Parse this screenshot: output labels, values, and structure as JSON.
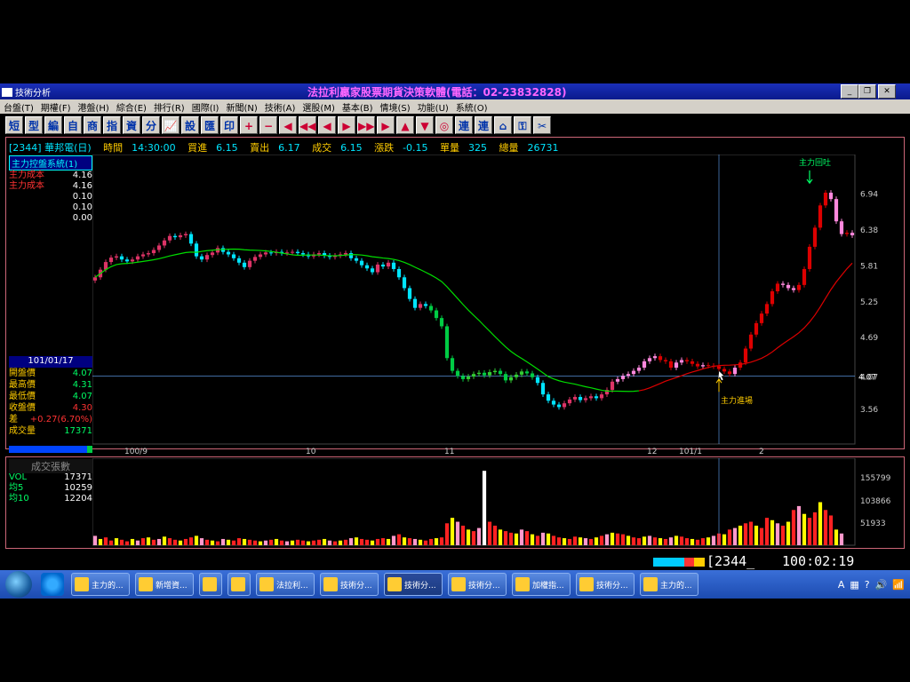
{
  "window": {
    "app_title": "技術分析",
    "brand_title": "法拉利贏家股票期貨決策軟體(電話：02-23832828)"
  },
  "menu": [
    "台盤(T)",
    "期權(F)",
    "港盤(H)",
    "綜合(E)",
    "排行(R)",
    "國際(I)",
    "新聞(N)",
    "技術(A)",
    "選股(M)",
    "基本(B)",
    "情境(S)",
    "功能(U)",
    "系統(O)"
  ],
  "toolbar": [
    {
      "label": "短",
      "cls": ""
    },
    {
      "label": "型",
      "cls": ""
    },
    {
      "label": "編",
      "cls": ""
    },
    {
      "label": "自",
      "cls": ""
    },
    {
      "label": "商",
      "cls": ""
    },
    {
      "label": "指",
      "cls": ""
    },
    {
      "label": "資",
      "cls": ""
    },
    {
      "label": "分",
      "cls": ""
    },
    {
      "label": "📈",
      "cls": ""
    },
    {
      "label": "設",
      "cls": ""
    },
    {
      "label": "匯",
      "cls": ""
    },
    {
      "label": "印",
      "cls": ""
    },
    {
      "label": "+",
      "cls": "red"
    },
    {
      "label": "−",
      "cls": "red"
    },
    {
      "label": "◀",
      "cls": "red"
    },
    {
      "label": "◀◀",
      "cls": "red"
    },
    {
      "label": "◀",
      "cls": "red"
    },
    {
      "label": "▶",
      "cls": "red"
    },
    {
      "label": "▶▶",
      "cls": "red"
    },
    {
      "label": "▶",
      "cls": "red"
    },
    {
      "label": "▲",
      "cls": "red"
    },
    {
      "label": "▼",
      "cls": "red"
    },
    {
      "label": "◎",
      "cls": "red"
    },
    {
      "label": "連",
      "cls": ""
    },
    {
      "label": "連",
      "cls": ""
    },
    {
      "label": "⌂",
      "cls": ""
    },
    {
      "label": "⚿",
      "cls": ""
    },
    {
      "label": "✂",
      "cls": ""
    }
  ],
  "info": {
    "stock": "[2344] 華邦電(日)",
    "time_label": "時間",
    "time": "14:30:00",
    "bid_label": "買進",
    "bid": "6.15",
    "ask_label": "賣出",
    "ask": "6.17",
    "trade_label": "成交",
    "trade": "6.15",
    "change_label": "漲跌",
    "change": "-0.15",
    "vol_label": "單量",
    "vol": "325",
    "total_label": "總量",
    "total": "26731"
  },
  "indicator": {
    "title": "主力控盤系統(1)",
    "rows": [
      {
        "k": "主力成本",
        "v": "4.16"
      },
      {
        "k": "主力成本",
        "v": "4.16"
      },
      {
        "k": "",
        "v": "0.10"
      },
      {
        "k": "",
        "v": "0.10"
      },
      {
        "k": "",
        "v": "0.00"
      }
    ]
  },
  "ohlc": {
    "date": "101/01/17",
    "rows": [
      {
        "k": "開盤價",
        "v": "4.07",
        "red": false
      },
      {
        "k": "最高價",
        "v": "4.31",
        "red": false
      },
      {
        "k": "最低價",
        "v": "4.07",
        "red": false
      },
      {
        "k": "收盤價",
        "v": "4.30",
        "red": true
      },
      {
        "k": "差",
        "v": "+0.27(6.70%)",
        "red": true
      },
      {
        "k": "成交量",
        "v": "17371",
        "red": false
      }
    ]
  },
  "volume_panel": {
    "title": "成交張數",
    "rows": [
      {
        "k": "VOL",
        "v": "17371"
      },
      {
        "k": "均5",
        "v": "10259"
      },
      {
        "k": "均10",
        "v": "12204"
      }
    ]
  },
  "chart_data": {
    "type": "candlestick",
    "price_axis": {
      "ticks": [
        6.94,
        6.38,
        5.81,
        5.25,
        4.69,
        4.07,
        3.56
      ],
      "ylim": [
        3.0,
        7.55
      ],
      "current_label": "4.07"
    },
    "x_tick_labels": [
      "100/9",
      "10",
      "11",
      "12",
      "101/1",
      "2"
    ],
    "annotations": {
      "entry": "主力進場",
      "exit": "主力回吐"
    },
    "volume_axis": {
      "ticks": [
        155799,
        103866,
        51933
      ]
    },
    "closes": [
      5.62,
      5.74,
      5.86,
      5.93,
      5.95,
      5.9,
      5.87,
      5.9,
      5.95,
      5.98,
      6.0,
      6.05,
      6.12,
      6.2,
      6.27,
      6.25,
      6.28,
      6.3,
      6.15,
      5.95,
      5.9,
      5.97,
      6.01,
      6.08,
      6.02,
      5.98,
      5.92,
      5.85,
      5.78,
      5.88,
      5.94,
      5.98,
      6.01,
      6.0,
      6.02,
      6.0,
      6.01,
      6.02,
      6.0,
      5.98,
      5.95,
      5.98,
      6.0,
      5.96,
      5.94,
      5.96,
      5.98,
      6.0,
      5.92,
      5.88,
      5.81,
      5.76,
      5.7,
      5.82,
      5.79,
      5.85,
      5.75,
      5.62,
      5.45,
      5.28,
      5.14,
      5.2,
      5.17,
      5.1,
      4.98,
      4.85,
      4.35,
      4.15,
      4.07,
      4.02,
      4.06,
      4.1,
      4.12,
      4.08,
      4.13,
      4.15,
      4.1,
      4.0,
      4.05,
      4.09,
      4.14,
      4.11,
      4.05,
      3.96,
      3.78,
      3.68,
      3.62,
      3.58,
      3.64,
      3.7,
      3.74,
      3.69,
      3.72,
      3.75,
      3.72,
      3.78,
      3.85,
      3.98,
      4.02,
      4.07,
      4.1,
      4.15,
      4.2,
      4.3,
      4.35,
      4.38,
      4.32,
      4.3,
      4.2,
      4.28,
      4.32,
      4.3,
      4.26,
      4.22,
      4.24,
      4.23,
      4.22,
      4.18,
      4.14,
      4.1,
      4.2,
      4.28,
      4.5,
      4.72,
      4.9,
      5.05,
      5.2,
      5.4,
      5.52,
      5.5,
      5.45,
      5.42,
      5.5,
      5.75,
      6.1,
      6.4,
      6.75,
      6.95,
      6.85,
      6.5,
      6.3,
      6.32,
      6.28
    ],
    "volumes": [
      12,
      8,
      10,
      6,
      9,
      7,
      5,
      8,
      6,
      9,
      10,
      7,
      8,
      11,
      9,
      7,
      6,
      8,
      10,
      12,
      9,
      7,
      6,
      5,
      8,
      7,
      6,
      9,
      8,
      7,
      6,
      5,
      6,
      7,
      8,
      6,
      5,
      6,
      7,
      6,
      5,
      6,
      7,
      8,
      6,
      5,
      6,
      7,
      9,
      10,
      8,
      7,
      6,
      8,
      9,
      8,
      12,
      14,
      10,
      9,
      8,
      7,
      6,
      8,
      9,
      10,
      28,
      35,
      30,
      25,
      20,
      18,
      22,
      95,
      30,
      25,
      20,
      18,
      16,
      15,
      20,
      18,
      14,
      12,
      16,
      15,
      12,
      10,
      9,
      8,
      11,
      10,
      9,
      8,
      10,
      12,
      14,
      16,
      15,
      14,
      12,
      10,
      9,
      11,
      12,
      10,
      9,
      8,
      10,
      12,
      11,
      9,
      8,
      7,
      9,
      10,
      12,
      15,
      14,
      20,
      22,
      25,
      28,
      30,
      25,
      22,
      35,
      32,
      28,
      25,
      30,
      45,
      50,
      40,
      35,
      42,
      55,
      45,
      38,
      20,
      15
    ]
  }
}
